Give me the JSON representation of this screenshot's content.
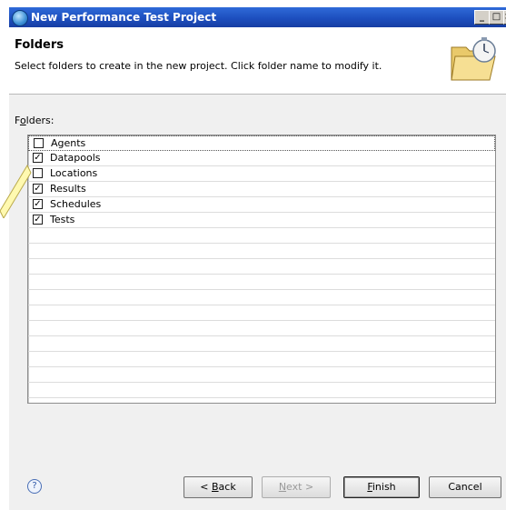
{
  "window": {
    "title": "New Performance Test Project",
    "controls": {
      "minimize": "_",
      "maximize": "□",
      "close": "×"
    }
  },
  "header": {
    "title": "Folders",
    "description": "Select folders to create in the new project. Click folder name to modify it.",
    "graphic_icon": "folder-stopwatch-icon"
  },
  "folders": {
    "label_prefix": "F",
    "label_underlined": "o",
    "label_rest": "lders:",
    "items": [
      {
        "name": "Agents",
        "checked": false
      },
      {
        "name": "Datapools",
        "checked": true
      },
      {
        "name": "Locations",
        "checked": false
      },
      {
        "name": "Results",
        "checked": true
      },
      {
        "name": "Schedules",
        "checked": true
      },
      {
        "name": "Tests",
        "checked": true
      }
    ]
  },
  "buttons": {
    "help": "?",
    "back_prefix": "< ",
    "back_mnemonic": "B",
    "back_rest": "ack",
    "next_mnemonic": "N",
    "next_rest": "ext >",
    "finish_mnemonic": "F",
    "finish_rest": "inish",
    "cancel": "Cancel"
  },
  "colors": {
    "titlebar": "#1d4fbf",
    "callout": "#fff9b0"
  }
}
